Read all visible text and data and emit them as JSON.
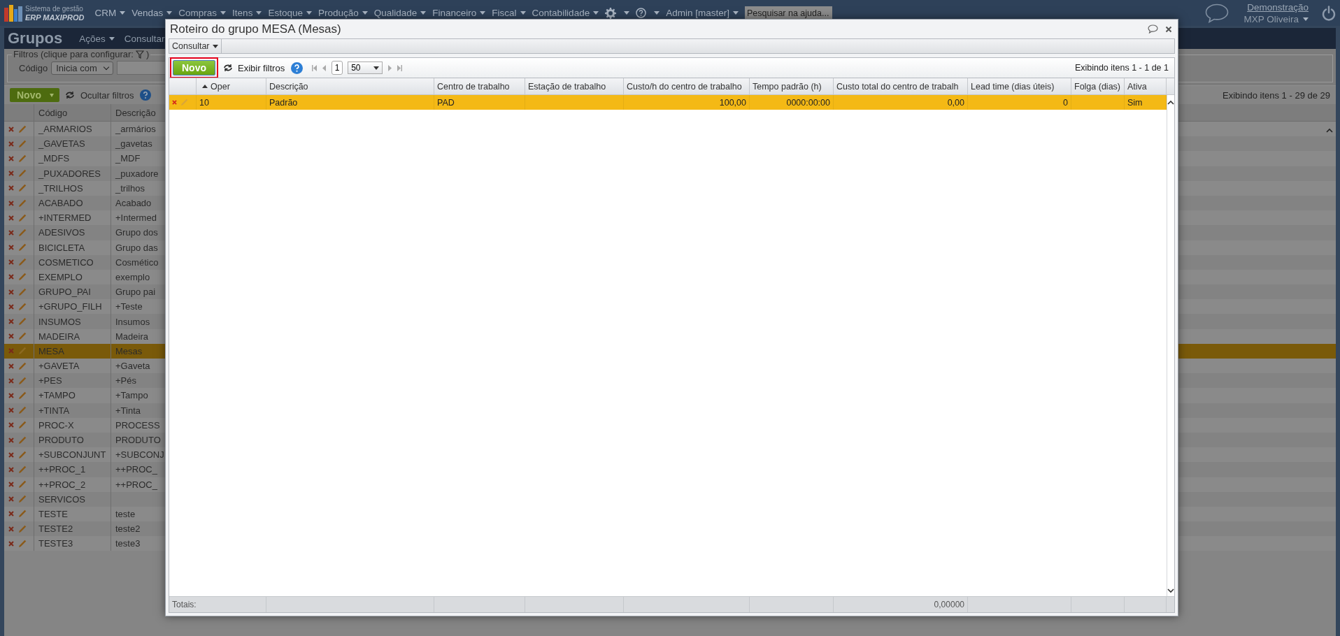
{
  "top_nav": {
    "logo": {
      "line1": "Sistema de gestão",
      "line2": "ERP MAXIPROD"
    },
    "menus": [
      {
        "label": "CRM"
      },
      {
        "label": "Vendas"
      },
      {
        "label": "Compras"
      },
      {
        "label": "Itens"
      },
      {
        "label": "Estoque"
      },
      {
        "label": "Produção"
      },
      {
        "label": "Qualidade"
      },
      {
        "label": "Financeiro"
      },
      {
        "label": "Fiscal"
      },
      {
        "label": "Contabilidade"
      }
    ],
    "admin": "Admin [master]",
    "search": {
      "placeholder": "Pesquisar na ajuda..."
    },
    "user": {
      "company": "Demonstração",
      "name": "MXP Oliveira"
    }
  },
  "page": {
    "title": "Grupos",
    "menus": [
      "Ações",
      "Consultar"
    ],
    "filters": {
      "legend": "Filtros (clique para configurar:",
      "legend_end": ")",
      "field": "Código",
      "operator": "Inicia com"
    },
    "toolbar": {
      "new": "Novo",
      "hide_filters": "Ocultar filtros",
      "count": "Exibindo itens 1 - 29 de 29"
    },
    "columns": [
      "Código",
      "Descrição"
    ],
    "rows": [
      {
        "codigo": "_ARMARIOS",
        "descricao": "_armários",
        "selected": false
      },
      {
        "codigo": "_GAVETAS",
        "descricao": "_gavetas",
        "selected": false
      },
      {
        "codigo": "_MDFS",
        "descricao": "_MDF",
        "selected": false
      },
      {
        "codigo": "_PUXADORES",
        "descricao": "_puxadore",
        "selected": false
      },
      {
        "codigo": "_TRILHOS",
        "descricao": "_trilhos",
        "selected": false
      },
      {
        "codigo": "ACABADO",
        "descricao": "Acabado",
        "selected": false
      },
      {
        "codigo": "+INTERMED",
        "descricao": "+Intermed",
        "selected": false
      },
      {
        "codigo": "ADESIVOS",
        "descricao": "Grupo dos",
        "selected": false
      },
      {
        "codigo": "BICICLETA",
        "descricao": "Grupo das",
        "selected": false
      },
      {
        "codigo": "COSMETICO",
        "descricao": "Cosmético",
        "selected": false
      },
      {
        "codigo": "EXEMPLO",
        "descricao": "exemplo",
        "selected": false
      },
      {
        "codigo": "GRUPO_PAI",
        "descricao": "Grupo pai",
        "selected": false
      },
      {
        "codigo": "+GRUPO_FILH",
        "descricao": "+Teste",
        "selected": false
      },
      {
        "codigo": "INSUMOS",
        "descricao": "Insumos",
        "selected": false
      },
      {
        "codigo": "MADEIRA",
        "descricao": "Madeira",
        "selected": false
      },
      {
        "codigo": "MESA",
        "descricao": "Mesas",
        "selected": true
      },
      {
        "codigo": "+GAVETA",
        "descricao": "+Gaveta",
        "selected": false
      },
      {
        "codigo": "+PES",
        "descricao": "+Pés",
        "selected": false
      },
      {
        "codigo": "+TAMPO",
        "descricao": "+Tampo",
        "selected": false
      },
      {
        "codigo": "+TINTA",
        "descricao": "+Tinta",
        "selected": false
      },
      {
        "codigo": "PROC-X",
        "descricao": "PROCESS",
        "selected": false
      },
      {
        "codigo": "PRODUTO",
        "descricao": "PRODUTO",
        "selected": false
      },
      {
        "codigo": "+SUBCONJUNT",
        "descricao": "+SUBCONJ",
        "selected": false
      },
      {
        "codigo": "++PROC_1",
        "descricao": "++PROC_",
        "selected": false
      },
      {
        "codigo": "++PROC_2",
        "descricao": "++PROC_",
        "selected": false
      },
      {
        "codigo": "SERVICOS",
        "selected": false
      },
      {
        "codigo": "TESTE",
        "descricao": "teste",
        "selected": false
      },
      {
        "codigo": "TESTE2",
        "descricao": "teste2",
        "selected": false
      },
      {
        "codigo": "TESTE3",
        "descricao": "teste3",
        "selected": false
      }
    ]
  },
  "dialog": {
    "title": "Roteiro do grupo MESA (Mesas)",
    "menu": "Consultar",
    "toolbar": {
      "new": "Novo",
      "highlighted": true,
      "show_filters": "Exibir filtros",
      "page": "1",
      "page_size": "50",
      "count": "Exibindo itens 1 - 1 de 1"
    },
    "columns": [
      {
        "label": "Oper",
        "kind": "text",
        "sorted": true
      },
      {
        "label": "Descrição",
        "kind": "text",
        "sorted": false
      },
      {
        "label": "Centro de trabalho",
        "kind": "text",
        "sorted": false
      },
      {
        "label": "Estação de trabalho",
        "kind": "text",
        "sorted": false
      },
      {
        "label": "Custo/h do centro de trabalho",
        "kind": "number",
        "sorted": false
      },
      {
        "label": "Tempo padrão (h)",
        "kind": "number",
        "sorted": false
      },
      {
        "label": "Custo total do centro de trabalh",
        "kind": "number",
        "sorted": false
      },
      {
        "label": "Lead time (dias úteis)",
        "kind": "number",
        "sorted": false
      },
      {
        "label": "Folga (dias)",
        "kind": "number",
        "sorted": false
      },
      {
        "label": "Ativa",
        "kind": "text",
        "sorted": false
      }
    ],
    "rows": [
      {
        "selected": true,
        "cells": [
          "10",
          "Padrão",
          "PAD",
          null,
          "100,00",
          "0000:00:00",
          "0,00",
          "0",
          null,
          "Sim"
        ]
      }
    ],
    "totals": {
      "label": "Totais:",
      "cells": [
        null,
        null,
        null,
        null,
        null,
        "0,00000",
        null,
        null,
        null
      ]
    }
  }
}
